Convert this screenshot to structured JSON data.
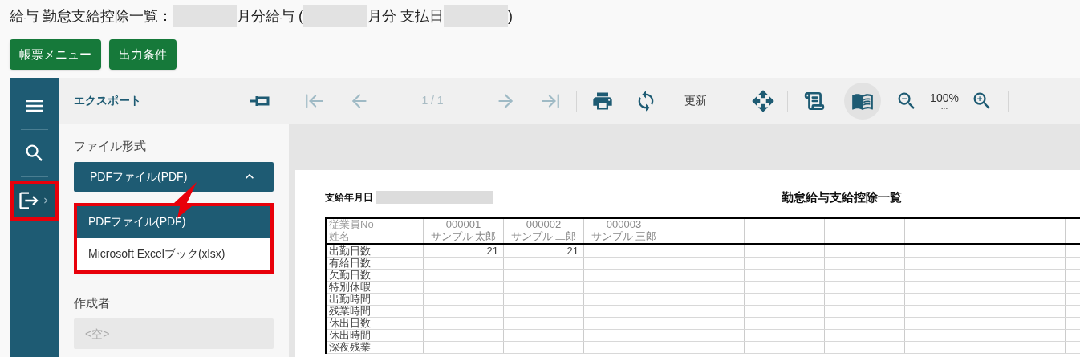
{
  "header": {
    "title_parts": [
      {
        "kind": "text",
        "text": "給与 勤怠支給控除一覧："
      },
      {
        "kind": "redacted"
      },
      {
        "kind": "text",
        "text": "月分給与 ("
      },
      {
        "kind": "redacted"
      },
      {
        "kind": "text",
        "text": "月分 支払日"
      },
      {
        "kind": "redacted"
      },
      {
        "kind": "text",
        "text": ")"
      }
    ],
    "buttons": [
      "帳票メニュー",
      "出力条件"
    ]
  },
  "sidebar": {
    "items": [
      {
        "kind": "menu",
        "selected": false,
        "highlighted": false
      },
      {
        "kind": "search",
        "selected": false,
        "highlighted": false
      },
      {
        "kind": "export",
        "selected": true,
        "highlighted": true
      }
    ]
  },
  "export_panel": {
    "title": "エクスポート",
    "file_format": {
      "label": "ファイル形式",
      "value": "PDFファイル(PDF)",
      "expanded": true,
      "highlighted": true,
      "options": [
        {
          "label": "PDFファイル(PDF)",
          "selected": true
        },
        {
          "label": "Microsoft Excelブック(xlsx)",
          "selected": false
        }
      ]
    },
    "author": {
      "label": "作成者",
      "placeholder": "<空>"
    }
  },
  "toolbar": {
    "navigation": [
      {
        "kind": "first",
        "disabled": true
      },
      {
        "kind": "prev",
        "disabled": true
      },
      {
        "kind": "page",
        "text": "1 / 1",
        "disabled": true
      },
      {
        "kind": "next",
        "disabled": true
      },
      {
        "kind": "last",
        "disabled": true
      }
    ],
    "refresh_label": "更新",
    "view_modes": [
      {
        "kind": "continuous",
        "selected": false
      },
      {
        "kind": "single",
        "selected": true
      }
    ],
    "zoom": "100%",
    "zoom_more": "..."
  },
  "report": {
    "date_label": "支給年月日",
    "title": "勤怠給与支給控除一覧",
    "header_rows": [
      {
        "label": "従業員No",
        "cells": [
          "000001",
          "000002",
          "000003"
        ]
      },
      {
        "label": "姓名",
        "cells": [
          "サンプル 太郎",
          "サンプル 二郎",
          "サンプル 三郎"
        ]
      }
    ],
    "rows": [
      {
        "label": "出勤日数",
        "values": [
          "21",
          "21"
        ]
      },
      {
        "label": "有給日数"
      },
      {
        "label": "欠勤日数"
      },
      {
        "label": "特別休暇"
      },
      {
        "label": "出勤時間"
      },
      {
        "label": "残業時間"
      },
      {
        "label": "休出日数"
      },
      {
        "label": "休出時間"
      },
      {
        "label": "深夜残業"
      }
    ]
  }
}
